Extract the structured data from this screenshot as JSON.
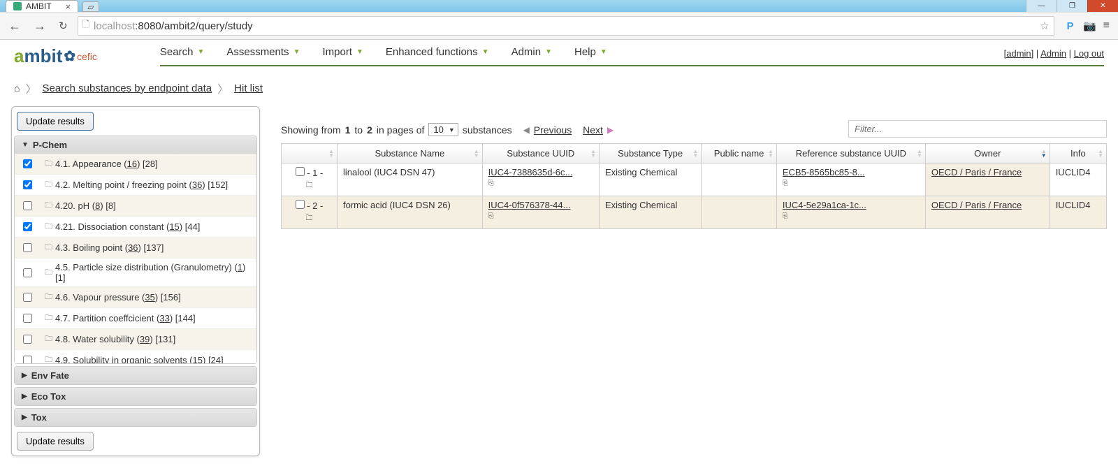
{
  "browser": {
    "tab_title": "AMBIT",
    "url_host": "localhost",
    "url_port": ":8080",
    "url_path": "/ambit2/query/study"
  },
  "header": {
    "menu": [
      "Search",
      "Assessments",
      "Import",
      "Enhanced functions",
      "Admin",
      "Help"
    ],
    "user_link": "[admin]",
    "admin_link": "Admin",
    "logout_link": "Log out"
  },
  "breadcrumb": {
    "search_page": "Search substances by endpoint data",
    "hit_list": "Hit list"
  },
  "sidebar": {
    "update_button": "Update results",
    "sections": {
      "pchem": {
        "title": "P-Chem"
      },
      "envfate": {
        "title": "Env Fate"
      },
      "ecotox": {
        "title": "Eco Tox"
      },
      "tox": {
        "title": "Tox"
      }
    },
    "pchem_items": [
      {
        "checked": true,
        "label": "4.1. Appearance",
        "count": "16",
        "bracket": "[28]"
      },
      {
        "checked": true,
        "label": "4.2. Melting point / freezing point",
        "count": "36",
        "bracket": "[152]"
      },
      {
        "checked": false,
        "label": "4.20. pH",
        "count": "8",
        "bracket": "[8]"
      },
      {
        "checked": true,
        "label": "4.21. Dissociation constant",
        "count": "15",
        "bracket": "[44]"
      },
      {
        "checked": false,
        "label": "4.3. Boiling point",
        "count": "36",
        "bracket": "[137]"
      },
      {
        "checked": false,
        "label": "4.5. Particle size distribution (Granulometry)",
        "count": "1",
        "bracket": "[1]"
      },
      {
        "checked": false,
        "label": "4.6. Vapour pressure",
        "count": "35",
        "bracket": "[156]"
      },
      {
        "checked": false,
        "label": "4.7. Partition coeffcicient",
        "count": "33",
        "bracket": "[144]"
      },
      {
        "checked": false,
        "label": "4.8. Water solubility",
        "count": "39",
        "bracket": "[131]"
      },
      {
        "checked": false,
        "label": "4.9. Solubility in organic solvents",
        "count": "15",
        "bracket": "[24]"
      }
    ]
  },
  "pager": {
    "showing_prefix": "Showing from",
    "from": "1",
    "to_word": "to",
    "to": "2",
    "in_pages": "in pages of",
    "page_size": "10",
    "substances": "substances",
    "previous": "Previous",
    "next": "Next",
    "filter_placeholder": "Filter..."
  },
  "table": {
    "headers": [
      "",
      "Substance Name",
      "Substance UUID",
      "Substance Type",
      "Public name",
      "Reference substance UUID",
      "Owner",
      "Info"
    ],
    "rows": [
      {
        "idx": "- 1 -",
        "name": "linalool (IUC4 DSN 47)",
        "uuid": "IUC4-7388635d-6c...",
        "type": "Existing Chemical",
        "public": "",
        "ref": "ECB5-8565bc85-8...",
        "owner": "OECD / Paris / France",
        "info": "IUCLID4"
      },
      {
        "idx": "- 2 -",
        "name": "formic acid (IUC4 DSN 26)",
        "uuid": "IUC4-0f576378-44...",
        "type": "Existing Chemical",
        "public": "",
        "ref": "IUC4-5e29a1ca-1c...",
        "owner": "OECD / Paris / France",
        "info": "IUCLID4"
      }
    ]
  }
}
